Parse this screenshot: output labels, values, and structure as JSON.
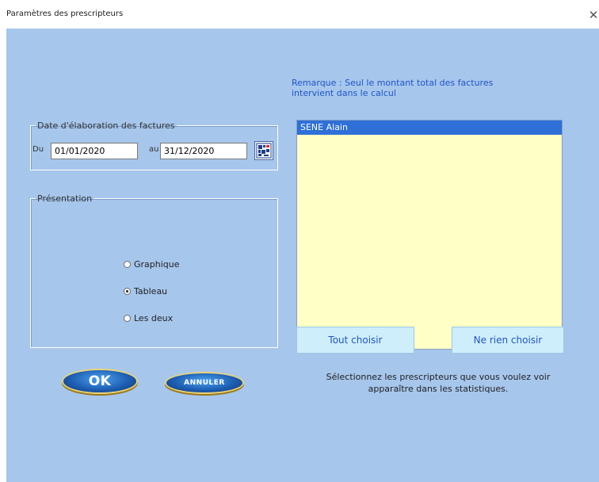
{
  "window": {
    "title": "Paramètres des prescripteurs",
    "close_glyph": "✕"
  },
  "remark": "Remarque : Seul le montant total des factures intervient dans le calcul",
  "dates": {
    "legend": "Date d'élaboration des factures",
    "from_label": "Du",
    "from_value": "01/01/2020",
    "to_label": "au",
    "to_value": "31/12/2020",
    "calendar_icon": "calendar-icon"
  },
  "presentation": {
    "legend": "Présentation",
    "options": [
      {
        "label": "Graphique",
        "checked": false
      },
      {
        "label": "Tableau",
        "checked": true
      },
      {
        "label": "Les deux",
        "checked": false
      }
    ]
  },
  "prescribers": {
    "items": [
      {
        "label": "SENE Alain",
        "selected": true
      }
    ],
    "select_all_label": "Tout choisir",
    "select_none_label": "Ne rien choisir",
    "help": "Sélectionnez les prescripteurs que vous voulez voir apparaître dans les statistiques."
  },
  "buttons": {
    "ok_label": "OK",
    "cancel_label": "ANNULER"
  },
  "colors": {
    "background": "#a6c6ec",
    "list_background": "#ffffc6",
    "selection": "#2e6fd8",
    "accent_text": "#2055c8"
  }
}
